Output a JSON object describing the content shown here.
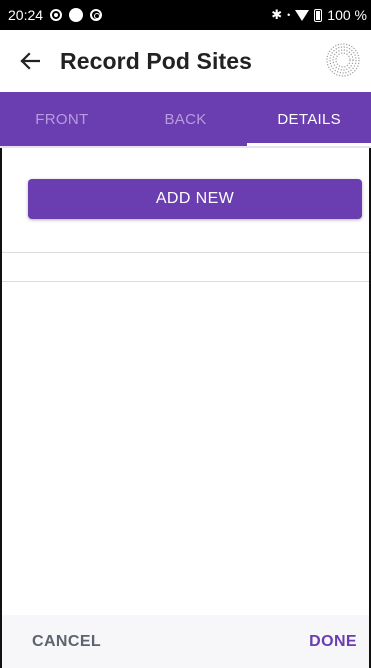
{
  "status_bar": {
    "time": "20:24",
    "battery": "100 %",
    "icons": [
      "record-dot-icon",
      "circle-icon",
      "at-sign-icon",
      "bluetooth-icon",
      "wifi-icon",
      "battery-icon"
    ]
  },
  "header": {
    "title": "Record Pod Sites",
    "back_icon": "arrow-left-icon",
    "sync_icon": "sync-spinner-icon"
  },
  "tabs": [
    {
      "label": "FRONT",
      "active": false
    },
    {
      "label": "BACK",
      "active": false
    },
    {
      "label": "DETAILS",
      "active": true
    }
  ],
  "main": {
    "add_new_label": "ADD NEW"
  },
  "footer": {
    "cancel_label": "CANCEL",
    "done_label": "DONE"
  },
  "colors": {
    "accent": "#6a3db0",
    "tab_inactive": "#b79ddf",
    "status_bar": "#000000"
  }
}
